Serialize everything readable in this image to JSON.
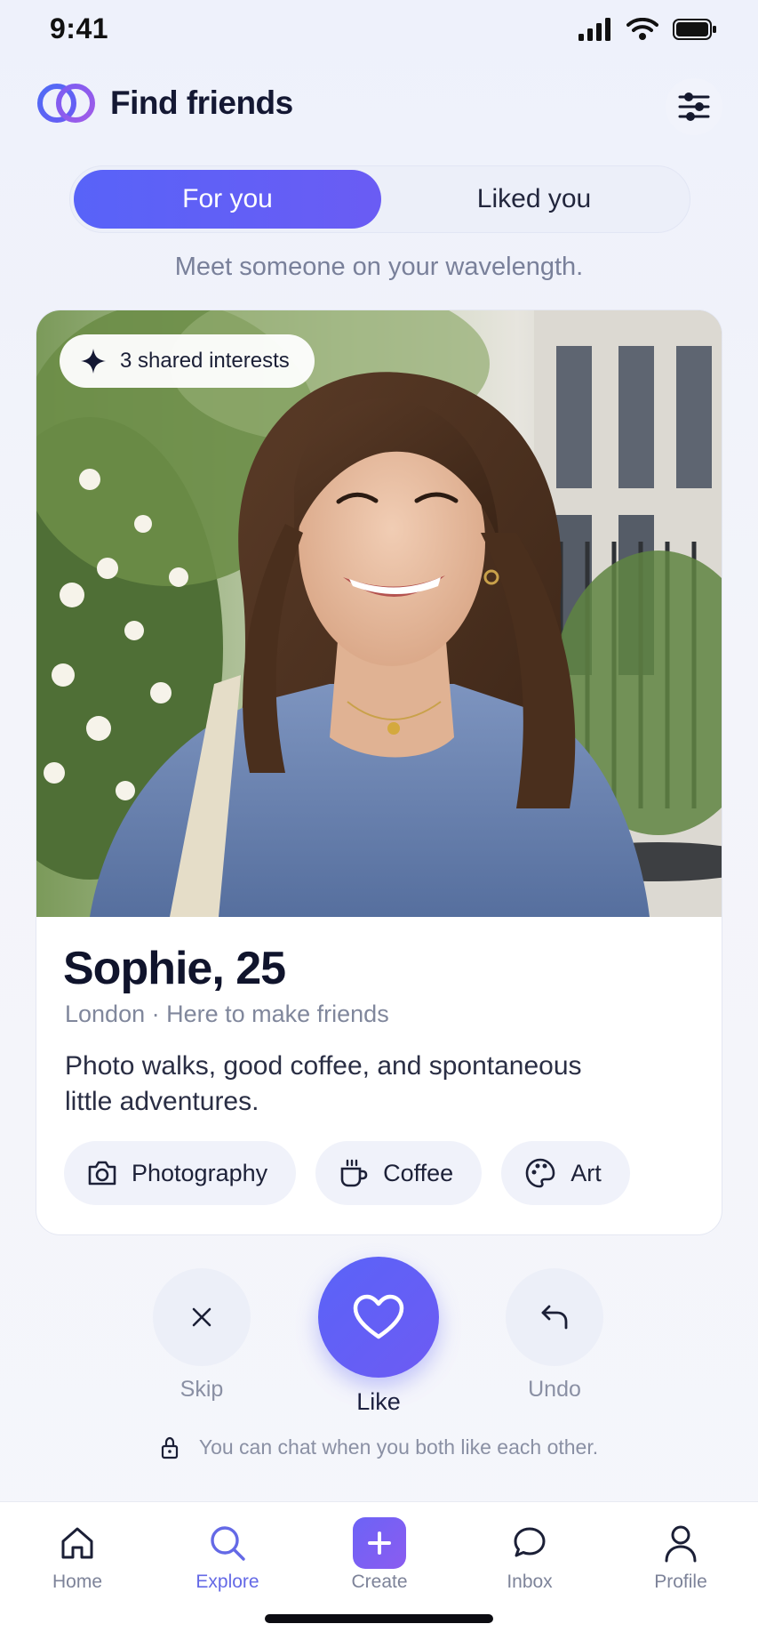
{
  "status_bar": {
    "time": "9:41"
  },
  "header": {
    "title": "Find friends"
  },
  "tabs": [
    {
      "label": "For you",
      "active": true
    },
    {
      "label": "Liked you",
      "active": false
    }
  ],
  "subtitle": "Meet someone on your wavelength.",
  "card": {
    "badge": "3 shared interests",
    "name": "Sophie, 25",
    "meta": "London · Here to make friends",
    "bio": "Photo walks, good coffee, and spontaneous little adventures.",
    "interests": [
      {
        "label": "Photography",
        "icon": "camera-icon"
      },
      {
        "label": "Coffee",
        "icon": "coffee-cup-icon"
      },
      {
        "label": "Art",
        "icon": "palette-icon"
      }
    ]
  },
  "actions": {
    "skip": "Skip",
    "like": "Like",
    "undo": "Undo"
  },
  "chat_note": "You can chat when you both like each other.",
  "nav": [
    {
      "label": "Home",
      "icon": "home-icon",
      "active": false
    },
    {
      "label": "Explore",
      "icon": "search-icon",
      "active": true
    },
    {
      "label": "Create",
      "icon": "plus-icon",
      "active": false
    },
    {
      "label": "Inbox",
      "icon": "chat-bubble-icon",
      "active": false
    },
    {
      "label": "Profile",
      "icon": "person-icon",
      "active": false
    }
  ],
  "colors": {
    "accent": "#5b63f8",
    "text_primary": "#141833",
    "text_muted": "#80879c"
  }
}
